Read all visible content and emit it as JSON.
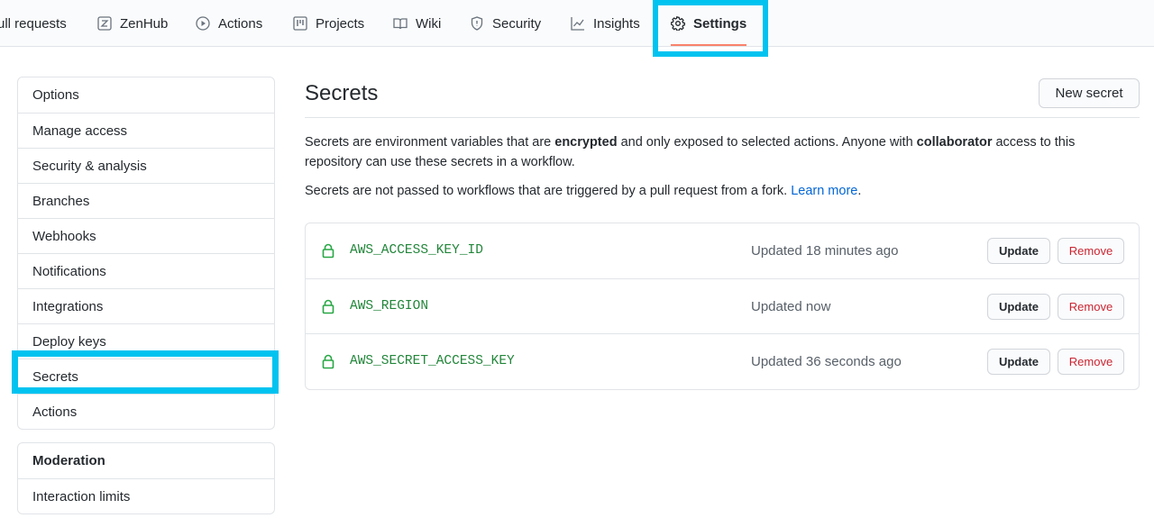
{
  "nav": {
    "tabs": [
      {
        "label": "ull requests",
        "icon": "pull-request-icon"
      },
      {
        "label": "ZenHub",
        "icon": "zenhub-icon"
      },
      {
        "label": "Actions",
        "icon": "play-icon"
      },
      {
        "label": "Projects",
        "icon": "project-icon"
      },
      {
        "label": "Wiki",
        "icon": "book-icon"
      },
      {
        "label": "Security",
        "icon": "shield-icon"
      },
      {
        "label": "Insights",
        "icon": "graph-icon"
      },
      {
        "label": "Settings",
        "icon": "gear-icon",
        "selected": true
      }
    ]
  },
  "sidebar": {
    "items": [
      {
        "label": "Options"
      },
      {
        "label": "Manage access"
      },
      {
        "label": "Security & analysis"
      },
      {
        "label": "Branches"
      },
      {
        "label": "Webhooks"
      },
      {
        "label": "Notifications"
      },
      {
        "label": "Integrations"
      },
      {
        "label": "Deploy keys"
      },
      {
        "label": "Secrets",
        "selected": true
      },
      {
        "label": "Actions"
      }
    ],
    "moderation": {
      "heading": "Moderation",
      "items": [
        {
          "label": "Interaction limits"
        }
      ]
    }
  },
  "main": {
    "title": "Secrets",
    "new_secret_label": "New secret",
    "intro": {
      "part1": "Secrets are environment variables that are ",
      "bold1": "encrypted",
      "part2": " and only exposed to selected actions. Anyone with ",
      "bold2": "collaborator",
      "part3": " access to this repository can use these secrets in a workflow."
    },
    "note": {
      "text": "Secrets are not passed to workflows that are triggered by a pull request from a fork. ",
      "link": "Learn more",
      "after": "."
    },
    "secrets": [
      {
        "name": "AWS_ACCESS_KEY_ID",
        "updated": "Updated 18 minutes ago",
        "update_label": "Update",
        "remove_label": "Remove"
      },
      {
        "name": "AWS_REGION",
        "updated": "Updated now",
        "update_label": "Update",
        "remove_label": "Remove"
      },
      {
        "name": "AWS_SECRET_ACCESS_KEY",
        "updated": "Updated 36 seconds ago",
        "update_label": "Update",
        "remove_label": "Remove"
      }
    ]
  },
  "colors": {
    "highlight": "#00c3f0",
    "selected_underline": "#f9826c",
    "secret_name": "#22863a",
    "remove_text": "#cb2431",
    "link": "#0366d6"
  }
}
